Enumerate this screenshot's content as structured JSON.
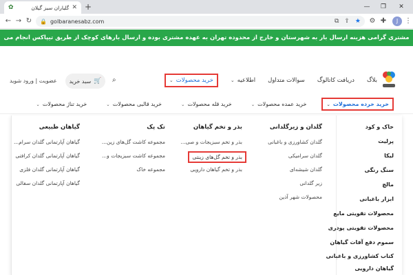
{
  "browser": {
    "tab_title": "گلباران سبز گیلان",
    "url": "golbaranesabz.com",
    "new_tab": "+",
    "profile_initial": "J"
  },
  "announcement": "مشتری گرامی هزینه ارسال بار به شهرستان و خارج از محدوده تهران به عهده مشتری بوده و ارسال بارهای کوچک از طریق تیپاکس انجام می شود.",
  "header": {
    "nav": [
      {
        "label": "خرید محصولات",
        "active": true
      },
      {
        "label": "اطلاعیه"
      },
      {
        "label": "سوالات متداول"
      },
      {
        "label": "دریافت کاتالوگ"
      },
      {
        "label": "بلاگ"
      }
    ],
    "cart_label": "سبد خرید",
    "login": "عضویت | ورود شوید"
  },
  "subnav": [
    {
      "label": "خرید خرده محصولات",
      "active": true
    },
    {
      "label": "خرید عمده محصولات"
    },
    {
      "label": "خرید قله محصولات"
    },
    {
      "label": "خرید قالبی محصولات"
    },
    {
      "label": "خرید تناژ محصولات"
    }
  ],
  "mega": {
    "categories": [
      "خاک و کود",
      "پرلیت",
      "لیکا",
      "سنگ رنگی",
      "مالچ",
      "ابزار باغبانی",
      "محصولات تقویتی مایع",
      "محصولات تقویتی پودری",
      "سموم دفع آفات گیاهان",
      "کتاب کشاورزی و باغبانی",
      "گیاهان دارویی"
    ],
    "columns": [
      {
        "title": "گلدان و زیرگلدانی",
        "items": [
          "گلدان کشاورزی و باغبانی",
          "گلدان سرامیکی",
          "گلدان شیشه‌ای",
          "زیر گلدانی",
          "محصولات شهر آذین"
        ]
      },
      {
        "title": "بذر و تخم گیاهان",
        "items": [
          "بذر و تخم سبزیجات و صی...",
          "بذر و تخم گل‌های زینتی",
          "بذر و تخم گیاهان دارویی"
        ],
        "highlight": 1
      },
      {
        "title": "تک پک",
        "items": [
          "مجموعه کاشت گل‌های زین...",
          "مجموعه کاشت سبزیجات و...",
          "مجموعه خاک"
        ]
      },
      {
        "title": "گیاهان طبیعی",
        "items": [
          "گیاهان آپارتمانی گلدان سرام...",
          "گیاهان آپارتمانی گلدان کرافتی",
          "گیاهان آپارتمانی گلدان فلزی",
          "گیاهان آپارتمانی گلدان سفالی"
        ]
      }
    ]
  },
  "colors": {
    "announce_bg": "#29a74a",
    "highlight_border": "#e53935",
    "active_text": "#1e6fd9"
  }
}
